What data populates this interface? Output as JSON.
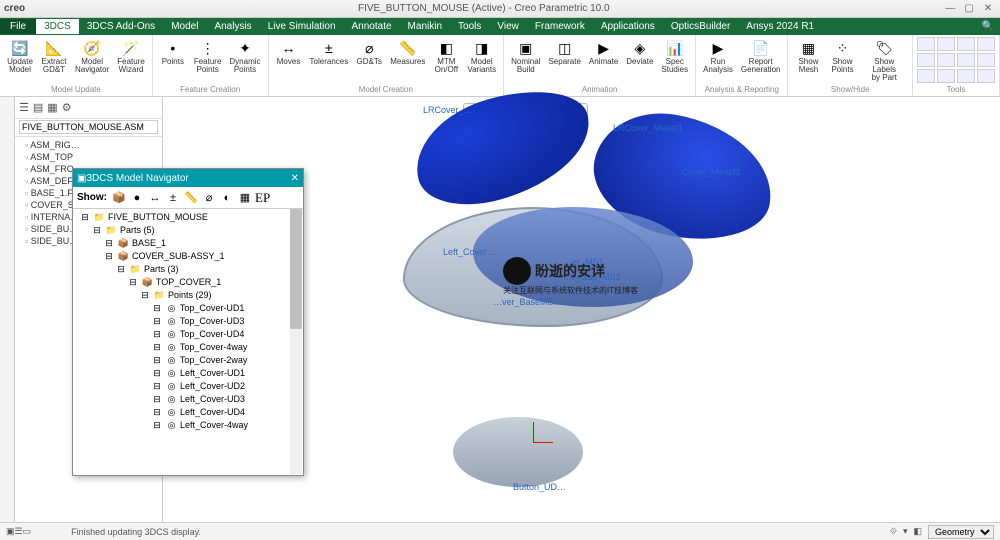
{
  "app": {
    "name": "creo",
    "title": "FIVE_BUTTON_MOUSE (Active) - Creo Parametric 10.0"
  },
  "menubar": {
    "file": "File",
    "tabs": [
      "3DCS",
      "3DCS Add-Ons",
      "Model",
      "Analysis",
      "Live Simulation",
      "Annotate",
      "Manikin",
      "Tools",
      "View",
      "Framework",
      "Applications",
      "OpticsBuilder",
      "Ansys 2024 R1"
    ],
    "active": 0
  },
  "ribbon": {
    "groups": [
      {
        "name": "Model Update",
        "buttons": [
          {
            "label": "Update\nModel",
            "icon": "🔄"
          },
          {
            "label": "Extract\nGD&T",
            "icon": "📐"
          },
          {
            "label": "Model\nNavigator",
            "icon": "🧭"
          },
          {
            "label": "Feature\nWizard",
            "icon": "🪄"
          }
        ]
      },
      {
        "name": "Feature Creation",
        "buttons": [
          {
            "label": "Points",
            "icon": "•"
          },
          {
            "label": "Feature\nPoints",
            "icon": "⋮"
          },
          {
            "label": "Dynamic\nPoints",
            "icon": "✦"
          }
        ]
      },
      {
        "name": "Model Creation",
        "buttons": [
          {
            "label": "Moves",
            "icon": "↔"
          },
          {
            "label": "Tolerances",
            "icon": "±"
          },
          {
            "label": "GD&Ts",
            "icon": "⌀"
          },
          {
            "label": "Measures",
            "icon": "📏"
          },
          {
            "label": "MTM\nOn/Off",
            "icon": "◧"
          },
          {
            "label": "Model\nVariants",
            "icon": "◨"
          }
        ]
      },
      {
        "name": "Animation",
        "buttons": [
          {
            "label": "Nominal\nBuild",
            "icon": "▣"
          },
          {
            "label": "Separate",
            "icon": "◫"
          },
          {
            "label": "Animate",
            "icon": "▶"
          },
          {
            "label": "Deviate",
            "icon": "◈"
          },
          {
            "label": "Spec\nStudies",
            "icon": "📊"
          }
        ]
      },
      {
        "name": "Analysis & Reporting",
        "buttons": [
          {
            "label": "Run\nAnalysis",
            "icon": "▶"
          },
          {
            "label": "Report\nGeneration",
            "icon": "📄"
          }
        ]
      },
      {
        "name": "Show/Hide",
        "buttons": [
          {
            "label": "Show\nMesh",
            "icon": "▦"
          },
          {
            "label": "Show\nPoints",
            "icon": "⁘"
          },
          {
            "label": "Show Labels\nby Part",
            "icon": "🏷"
          }
        ]
      },
      {
        "name": "Tools",
        "grid": true
      }
    ]
  },
  "model_tree": {
    "root": "FIVE_BUTTON_MOUSE.ASM",
    "items": [
      "ASM_RIG…",
      "ASM_TOP",
      "ASM_FRO…",
      "ASM_DEF…",
      "BASE_1.F…",
      "COVER_S…",
      "INTERNA…",
      "SIDE_BU…",
      "SIDE_BU…"
    ]
  },
  "navigator": {
    "title": "3DCS Model Navigator",
    "show_label": "Show:",
    "ep": "EP",
    "tree": [
      {
        "d": 0,
        "i": "📁",
        "t": "FIVE_BUTTON_MOUSE"
      },
      {
        "d": 1,
        "i": "📁",
        "t": "Parts (5)"
      },
      {
        "d": 2,
        "i": "📦",
        "t": "BASE_1"
      },
      {
        "d": 2,
        "i": "📦",
        "t": "COVER_SUB-ASSY_1"
      },
      {
        "d": 3,
        "i": "📁",
        "t": "Parts (3)"
      },
      {
        "d": 4,
        "i": "📦",
        "t": "TOP_COVER_1"
      },
      {
        "d": 5,
        "i": "📁",
        "t": "Points (29)"
      },
      {
        "d": 6,
        "i": "◎",
        "t": "Top_Cover-UD1"
      },
      {
        "d": 6,
        "i": "◎",
        "t": "Top_Cover-UD3"
      },
      {
        "d": 6,
        "i": "◎",
        "t": "Top_Cover-UD4"
      },
      {
        "d": 6,
        "i": "◎",
        "t": "Top_Cover-4way"
      },
      {
        "d": 6,
        "i": "◎",
        "t": "Top_Cover-2way"
      },
      {
        "d": 6,
        "i": "◎",
        "t": "Left_Cover-UD1"
      },
      {
        "d": 6,
        "i": "◎",
        "t": "Left_Cover-UD2"
      },
      {
        "d": 6,
        "i": "◎",
        "t": "Left_Cover-UD3"
      },
      {
        "d": 6,
        "i": "◎",
        "t": "Left_Cover-UD4"
      },
      {
        "d": 6,
        "i": "◎",
        "t": "Left_Cover-4way"
      }
    ]
  },
  "annotations": {
    "a1": "LRCover_…",
    "a2": "LRCover_Measf1",
    "a3": "…Cover_Measf2",
    "a4": "Left_Cover…",
    "a5": "…er_MS1",
    "a6": "…r_Gap_MS2",
    "a7": "…ver_BaseMS…",
    "a8": "Button_UD…"
  },
  "watermark": {
    "line1": "盼逝的安详",
    "line2": "关注互联网与系统软件技术的IT技博客"
  },
  "status": {
    "msg": "Finished updating 3DCS display.",
    "selector": "Geometry"
  }
}
